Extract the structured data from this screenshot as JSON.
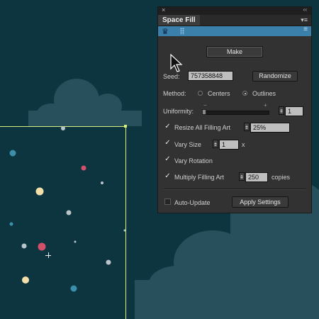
{
  "panel": {
    "close_glyph": "×",
    "collapse_glyph": "‹‹",
    "tab_title": "Space Fill",
    "menu_glyph": "▾≡",
    "bar_menu_glyph": "≡",
    "crown_glyph": "♛",
    "make_label": "Make",
    "seed_label": "Seed:",
    "seed_value": "757358848",
    "randomize_label": "Randomize",
    "method_label": "Method:",
    "method_options": [
      "Centers",
      "Outlines"
    ],
    "method_selected": "Outlines",
    "uniformity_label": "Uniformity:",
    "uniformity_minus": "−",
    "uniformity_plus": "+",
    "uniformity_value": "1",
    "uniformity_level": 0,
    "resize_label": "Resize All Filling Art",
    "resize_checked": true,
    "resize_value": "25%",
    "vary_size_label": "Vary Size",
    "vary_size_checked": true,
    "vary_size_value": "1",
    "vary_size_suffix": "x",
    "vary_rotation_label": "Vary Rotation",
    "vary_rotation_checked": true,
    "multiply_label": "Multiply Filling Art",
    "multiply_checked": true,
    "multiply_value": "250",
    "multiply_suffix": "copies",
    "auto_update_label": "Auto-Update",
    "auto_update_checked": false,
    "apply_label": "Apply Settings",
    "check_glyph": "✓"
  },
  "colors": {
    "background": "#0d3540",
    "cloud": "#28505c",
    "selection": "#d8f07a",
    "panel_accent": "#3b7fab"
  }
}
